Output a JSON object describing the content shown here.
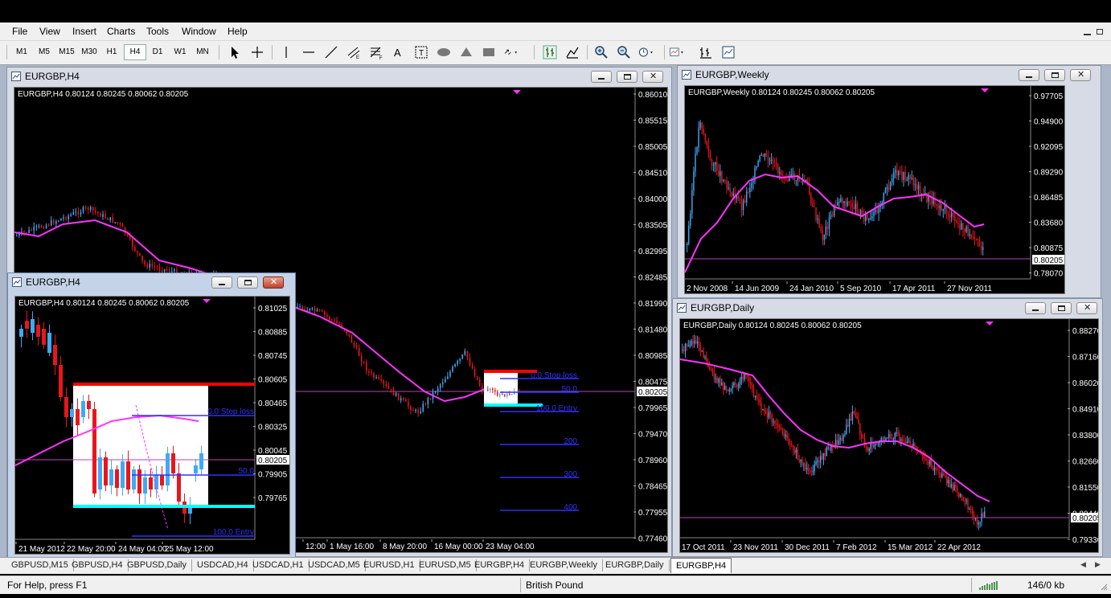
{
  "menu": [
    "File",
    "View",
    "Insert",
    "Charts",
    "Tools",
    "Window",
    "Help"
  ],
  "timeframes": [
    "M1",
    "M5",
    "M15",
    "M30",
    "H1",
    "H4",
    "D1",
    "W1",
    "MN"
  ],
  "active_timeframe": "H4",
  "windows": {
    "h4_main": {
      "title": "EURGBP,H4",
      "header": "EURGBP,H4  0.80124 0.80245 0.80062 0.80205",
      "price_labels": [
        "0.86010",
        "0.85515",
        "0.85005",
        "0.84510",
        "0.84000",
        "0.83505",
        "0.82995",
        "0.82485",
        "0.81990",
        "0.81480",
        "0.80985",
        "0.80475",
        "0.80205",
        "0.79965",
        "0.79470",
        "0.78960",
        "0.78465",
        "0.77955",
        "0.77460"
      ],
      "time_labels": [
        "12:00",
        "1 May 16:00",
        "8 May 20:00",
        "16 May 00:00",
        "23 May 04:00"
      ],
      "fib_labels": [
        "0.0 Stop loss",
        "50.0",
        "100.0 Entry",
        "200",
        "300",
        "400"
      ]
    },
    "h4_small": {
      "title": "EURGBP,H4",
      "header": "EURGBP,H4  0.80124 0.80245 0.80062 0.80205",
      "price_labels": [
        "0.81025",
        "0.80885",
        "0.80745",
        "0.80605",
        "0.80465",
        "0.80325",
        "0.80205",
        "0.80045",
        "0.79905",
        "0.79765"
      ],
      "time_labels": [
        "21 May 2012",
        "22 May 20:00",
        "24 May 04:00",
        "25 May 12:00"
      ],
      "fib_labels": [
        "0.0 Stop loss",
        "50.0",
        "100.0 Entry"
      ]
    },
    "weekly": {
      "title": "EURGBP,Weekly",
      "header": "EURGBP,Weekly  0.80124 0.80245 0.80062 0.80205",
      "price_labels": [
        "0.97705",
        "0.94900",
        "0.92095",
        "0.89290",
        "0.86485",
        "0.83680",
        "0.80875",
        "0.80205",
        "0.78070"
      ],
      "time_labels": [
        "2 Nov 2008",
        "14 Jun 2009",
        "24 Jan 2010",
        "5 Sep 2010",
        "17 Apr 2011",
        "27 Nov 2011"
      ]
    },
    "daily": {
      "title": "EURGBP,Daily",
      "header": "EURGBP,Daily  0.80124 0.80245 0.80062 0.80205",
      "price_labels": [
        "0.88270",
        "0.87160",
        "0.86020",
        "0.84910",
        "0.83800",
        "0.82660",
        "0.81550",
        "0.80440",
        "0.80205",
        "0.79330"
      ],
      "time_labels": [
        "17 Oct 2011",
        "23 Nov 2011",
        "30 Dec 2011",
        "7 Feb 2012",
        "15 Mar 2012",
        "22 Apr 2012"
      ]
    }
  },
  "tabs": [
    "GBPUSD,M15",
    "GBPUSD,H4",
    "GBPUSD,Daily",
    "USDCAD,H4",
    "USDCAD,H1",
    "USDCAD,M5",
    "EURUSD,H1",
    "EURUSD,M5",
    "EURGBP,H4",
    "EURGBP,Weekly",
    "EURGBP,Daily",
    "EURGBP,H4"
  ],
  "active_tab_index": 11,
  "status": {
    "help": "For Help, press F1",
    "symbol": "British Pound",
    "traffic": "146/0 kb"
  },
  "colors": {
    "bull": "#3fa9f5",
    "bear": "#e8161b",
    "ma": "#ff33ff",
    "bid_line": "#c040c0",
    "stop": "#ff0000",
    "entry": "#00ffff",
    "fib": "#3030ff"
  },
  "icons": {
    "window": "chart-window-icon",
    "minimize": "minimize-icon",
    "maximize": "maximize-icon",
    "close": "close-icon"
  }
}
